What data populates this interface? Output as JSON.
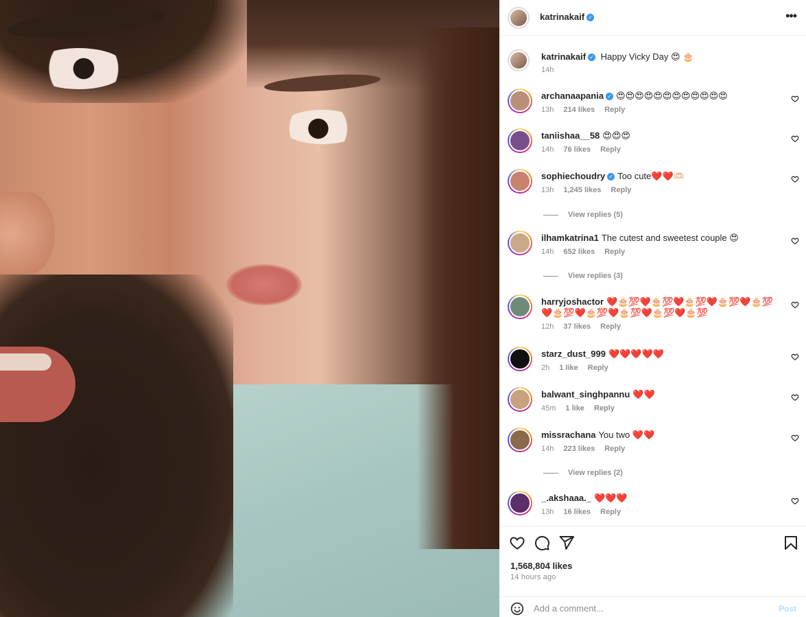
{
  "post": {
    "author": "katrinakaif",
    "author_verified": true,
    "photo_alt": "Selfie of a couple"
  },
  "caption": {
    "username": "katrinakaif",
    "text": "Happy Vicky Day 😍 🎂",
    "time": "14h"
  },
  "comments": [
    {
      "username": "archanaapania",
      "verified": true,
      "text": "😍😍😍😍😍😍😍😍😍😍😍😍",
      "time": "13h",
      "likes": "214 likes",
      "reply": "Reply",
      "avatar_color": "#b98f7a"
    },
    {
      "username": "taniishaa__58",
      "verified": false,
      "text": "😍😍😍",
      "time": "14h",
      "likes": "76 likes",
      "reply": "Reply",
      "avatar_color": "#7a4e8a"
    },
    {
      "username": "sophiechoudry",
      "verified": true,
      "text": "Too cute❤️❤️🫶🏻",
      "time": "13h",
      "likes": "1,245 likes",
      "reply": "Reply",
      "avatar_color": "#c7836e",
      "view_replies": "View replies (5)"
    },
    {
      "username": "ilhamkatrina1",
      "verified": false,
      "text": "The cutest and sweetest couple 😍",
      "time": "14h",
      "likes": "652 likes",
      "reply": "Reply",
      "avatar_color": "#c9a98a",
      "view_replies": "View replies (3)"
    },
    {
      "username": "harryjoshactor",
      "verified": false,
      "text": "❤️🎂💯❤️🎂💯❤️🎂💯❤️🎂💯❤️🎂💯❤️🎂💯❤️🎂💯❤️🎂💯❤️🎂💯❤️🎂💯",
      "time": "12h",
      "likes": "37 likes",
      "reply": "Reply",
      "avatar_color": "#6f8a78"
    },
    {
      "username": "starz_dust_999",
      "verified": false,
      "text": "❤️❤️❤️❤️❤️",
      "time": "2h",
      "likes": "1 like",
      "reply": "Reply",
      "avatar_color": "#111111"
    },
    {
      "username": "balwant_singhpannu",
      "verified": false,
      "text": "❤️❤️",
      "time": "45m",
      "likes": "1 like",
      "reply": "Reply",
      "avatar_color": "#c8a27e"
    },
    {
      "username": "missrachana",
      "verified": false,
      "text": "You two ❤️❤️",
      "time": "14h",
      "likes": "223 likes",
      "reply": "Reply",
      "avatar_color": "#8a6a4a",
      "view_replies": "View replies (2)"
    },
    {
      "username": "_.akshaaa._",
      "verified": false,
      "text": "❤️❤️❤️",
      "time": "13h",
      "likes": "16 likes",
      "reply": "Reply",
      "avatar_color": "#5a2f6a"
    }
  ],
  "actions": {
    "likes_total": "1,568,804 likes",
    "timestamp": "14 hours ago"
  },
  "comment_box": {
    "placeholder": "Add a comment...",
    "post_label": "Post"
  },
  "icons": {
    "like": "heart-outline-icon",
    "comment": "speech-bubble-icon",
    "share": "paper-plane-icon",
    "save": "bookmark-icon",
    "emoji": "smiley-icon",
    "more": "ellipsis-icon"
  },
  "colors": {
    "text": "#262626",
    "muted": "#8e8e8e",
    "verified": "#3897f0",
    "post_disabled": "#b2dffc"
  }
}
